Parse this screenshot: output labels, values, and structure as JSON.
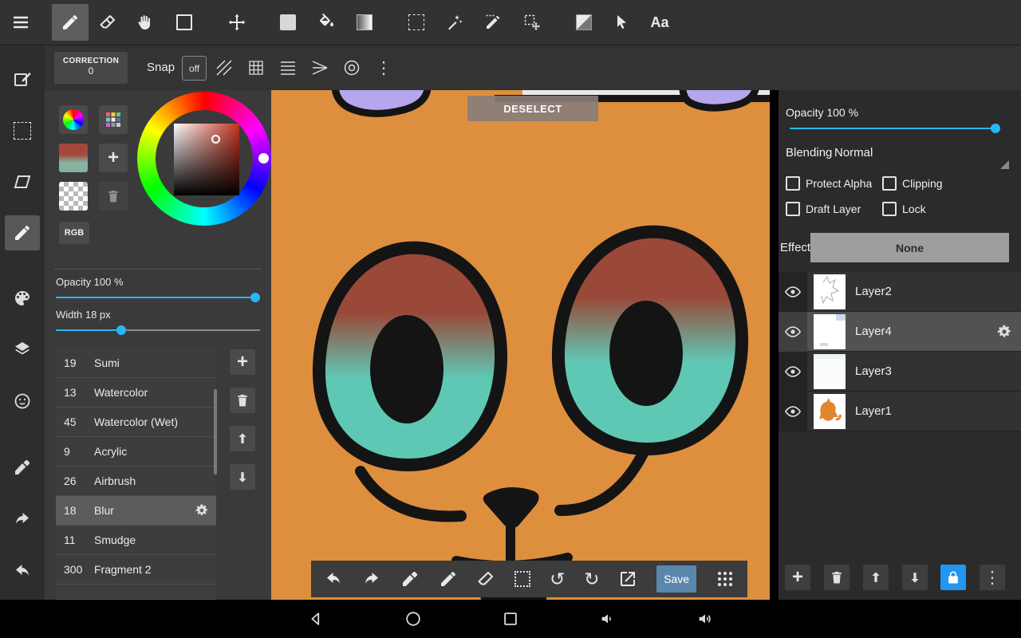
{
  "colors": {
    "accent_cyan": "#29b6f6",
    "save_blue": "#5b87ad",
    "lock_blue": "#2196f3",
    "canvas_orange": "#dd8f3e"
  },
  "topbar": {
    "text_tool_label": "Aa"
  },
  "snapbar": {
    "correction_label": "CORRECTION",
    "correction_value": "0",
    "snap_label": "Snap",
    "snap_toggle": "off"
  },
  "color_panel": {
    "rgb_label": "RGB"
  },
  "brush_panel": {
    "opacity_label": "Opacity 100 %",
    "width_label": "Width 18 px",
    "selected_brush": "18 Blur",
    "brushes": [
      {
        "id": "19",
        "name": "Sumi"
      },
      {
        "id": "13",
        "name": "Watercolor"
      },
      {
        "id": "45",
        "name": "Watercolor (Wet)"
      },
      {
        "id": "9",
        "name": "Acrylic"
      },
      {
        "id": "26",
        "name": "Airbrush"
      },
      {
        "id": "18",
        "name": "Blur"
      },
      {
        "id": "11",
        "name": "Smudge"
      },
      {
        "id": "300",
        "name": "Fragment 2"
      }
    ]
  },
  "canvas": {
    "deselect_button": "DESELECT",
    "save_button": "Save"
  },
  "layer_panel": {
    "opacity_label": "Opacity 100 %",
    "blending_label": "Blending",
    "blending_value": "Normal",
    "checkbox_labels": [
      "Protect Alpha",
      "Clipping",
      "Draft Layer",
      "Lock"
    ],
    "effect_label": "Effect",
    "effect_value": "None",
    "selected_layer": "Layer4",
    "layers": [
      {
        "name": "Layer2"
      },
      {
        "name": "Layer4"
      },
      {
        "name": "Layer3"
      },
      {
        "name": "Layer1"
      }
    ]
  }
}
